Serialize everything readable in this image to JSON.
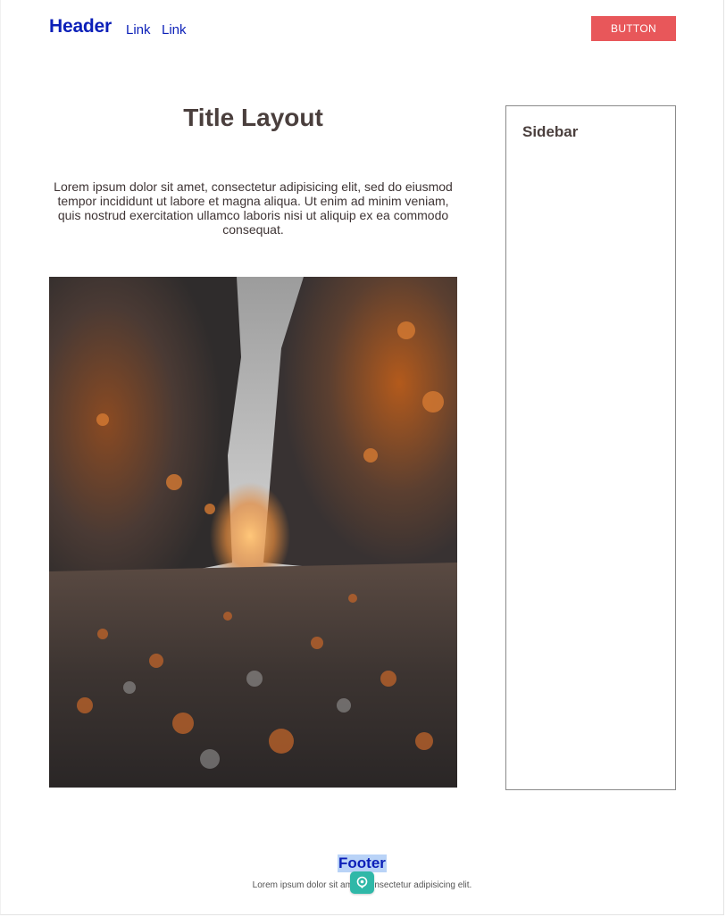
{
  "header": {
    "brand": "Header",
    "links": [
      "Link",
      "Link"
    ],
    "button_label": "BUTTON"
  },
  "main": {
    "title": "Title Layout",
    "intro": "Lorem ipsum dolor sit amet, consectetur adipisicing elit, sed do eiusmod tempor incididunt ut labore et magna aliqua. Ut enim ad minim veniam, quis nostrud exercitation ullamco laboris nisi ut aliquip ex ea commodo consequat.",
    "image_icon": "autumn-forest-path-photo"
  },
  "sidebar": {
    "title": "Sidebar"
  },
  "footer": {
    "title": "Footer",
    "text": "Lorem ipsum dolor sit amet, consectetur adipisicing elit."
  },
  "badge": {
    "icon": "assistant-icon"
  },
  "colors": {
    "link": "#0b1fb8",
    "button": "#e8575a",
    "heading": "#4a3f3d",
    "badge": "#2fb8a8"
  }
}
